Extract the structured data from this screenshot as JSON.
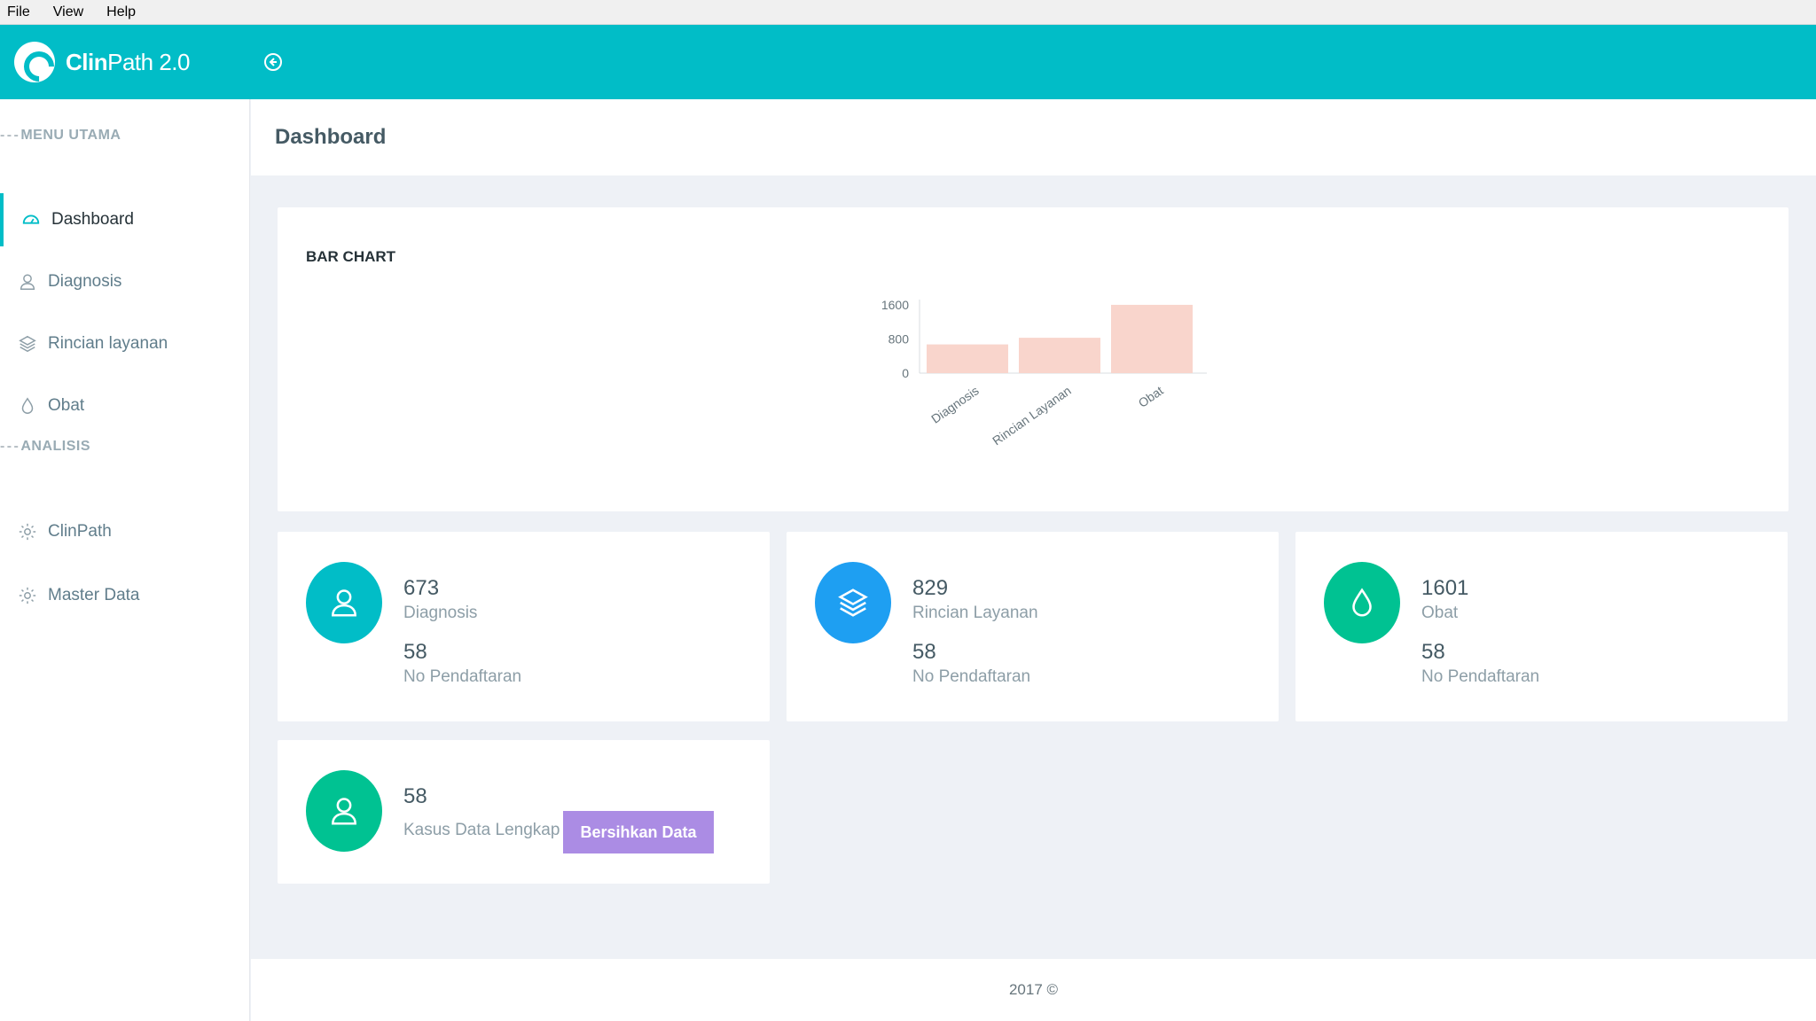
{
  "menubar": {
    "file": "File",
    "view": "View",
    "help": "Help"
  },
  "header": {
    "brand_bold": "Clin",
    "brand_rest": "Path 2.0"
  },
  "sidebar": {
    "section_main": "MENU UTAMA",
    "section_analysis": "ANALISIS",
    "items": [
      {
        "label": "Dashboard",
        "icon": "gauge-icon",
        "active": true
      },
      {
        "label": "Diagnosis",
        "icon": "user-icon"
      },
      {
        "label": "Rincian layanan",
        "icon": "layers-icon"
      },
      {
        "label": "Obat",
        "icon": "droplet-icon"
      },
      {
        "label": "ClinPath",
        "icon": "gear-icon"
      },
      {
        "label": "Master Data",
        "icon": "gear-icon"
      }
    ]
  },
  "page": {
    "title": "Dashboard"
  },
  "chart_data": {
    "type": "bar",
    "title": "BAR CHART",
    "categories": [
      "Diagnosis",
      "Rincian Layanan",
      "Obat"
    ],
    "values": [
      673,
      829,
      1601
    ],
    "yticks": [
      "1600",
      "800",
      "0"
    ],
    "ylim": [
      0,
      1600
    ],
    "bar_color": "#f9d5cc",
    "grid": false
  },
  "stats": [
    {
      "count": "673",
      "label": "Diagnosis",
      "sub_count": "58",
      "sub_label": "No Pendaftaran",
      "color": "#01bdc7",
      "icon": "user-icon"
    },
    {
      "count": "829",
      "label": "Rincian Layanan",
      "sub_count": "58",
      "sub_label": "No Pendaftaran",
      "color": "#1e9ff2",
      "icon": "layers-icon"
    },
    {
      "count": "1601",
      "label": "Obat",
      "sub_count": "58",
      "sub_label": "No Pendaftaran",
      "color": "#00c292",
      "icon": "droplet-icon"
    }
  ],
  "kasus": {
    "count": "58",
    "label": "Kasus Data Lengkap",
    "button": "Bersihkan Data",
    "color": "#00c292"
  },
  "footer": {
    "text": "2017 ©"
  }
}
